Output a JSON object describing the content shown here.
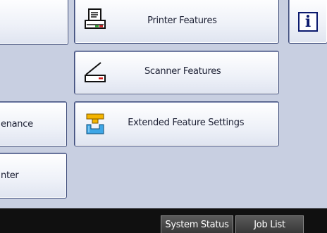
{
  "left_column": {
    "item_3_label": "enance",
    "item_4_label": "nter"
  },
  "main_buttons": {
    "printer_label": "Printer Features",
    "scanner_label": "Scanner Features",
    "extended_label": "Extended Feature Settings"
  },
  "info_button": {
    "glyph": "i"
  },
  "status_bar": {
    "system_status_label": "System Status",
    "job_list_label": "Job List"
  },
  "colors": {
    "background": "#c8cfe1",
    "button_border": "#3c4a78",
    "status_bar": "#101010"
  },
  "icons": [
    "printer-icon",
    "scanner-icon",
    "extended-feature-icon",
    "info-icon"
  ]
}
